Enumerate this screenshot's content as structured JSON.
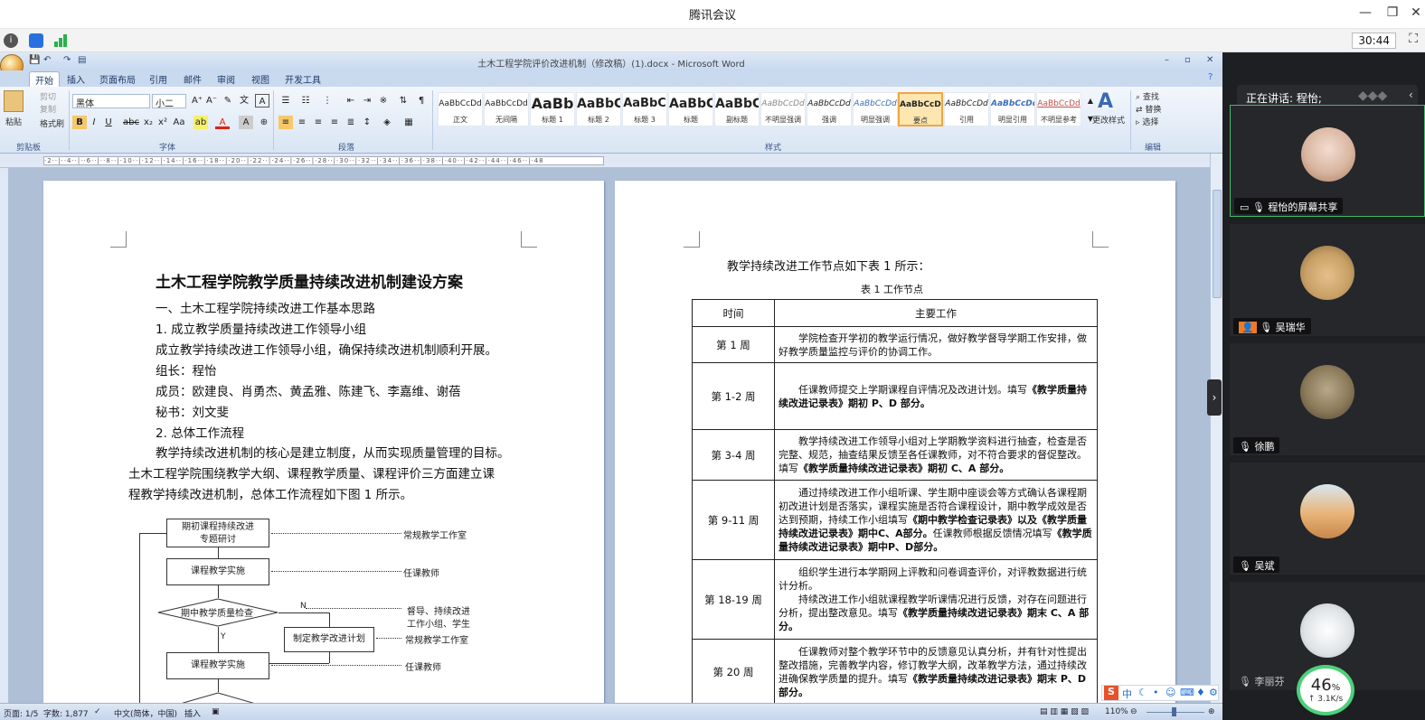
{
  "meeting": {
    "app_title": "腾讯会议",
    "timer": "30:44",
    "speaking_label": "正在讲话: 程怡;",
    "network": {
      "percent": "46",
      "percent_unit": "%",
      "speed": "3.1K/s"
    },
    "participants": [
      {
        "name": "程怡的屏幕共享",
        "avatar_color": "#d9b6a0"
      },
      {
        "name": "吴瑞华",
        "avatar_color": "#c8a066"
      },
      {
        "name": "徐鹏",
        "avatar_color": "#8a7a5a"
      },
      {
        "name": "吴斌",
        "avatar_color": "#c8874a"
      },
      {
        "name": "李丽芬",
        "avatar_color": "#dfe3e6"
      }
    ]
  },
  "word": {
    "window_title": "土木工程学院评价改进机制（修改稿）(1).docx - Microsoft Word",
    "tabs": [
      "开始",
      "插入",
      "页面布局",
      "引用",
      "邮件",
      "审阅",
      "视图",
      "开发工具"
    ],
    "clipboard": {
      "paste": "粘贴",
      "cut": "剪切",
      "copy": "复制",
      "format_painter": "格式刷",
      "group": "剪贴板"
    },
    "font": {
      "name": "黑体",
      "size": "小二",
      "group": "字体"
    },
    "paragraph_group": "段落",
    "styles_group": "样式",
    "editing_group": "编辑",
    "editing": {
      "find": "查找",
      "replace": "替换",
      "select": "选择",
      "change_styles": "更改样式"
    },
    "styles": [
      {
        "sample": "AaBbCcDd",
        "name": "正文"
      },
      {
        "sample": "AaBbCcDd",
        "name": "无间隔"
      },
      {
        "sample": "AaBb",
        "name": "标题 1"
      },
      {
        "sample": "AaBbC",
        "name": "标题 2"
      },
      {
        "sample": "AaBbC",
        "name": "标题 3"
      },
      {
        "sample": "AaBbC",
        "name": "标题"
      },
      {
        "sample": "AaBbC",
        "name": "副标题"
      },
      {
        "sample": "AaBbCcDd",
        "name": "不明显强调"
      },
      {
        "sample": "AaBbCcDd",
        "name": "强调"
      },
      {
        "sample": "AaBbCcDd",
        "name": "明显强调"
      },
      {
        "sample": "AaBbCcDd",
        "name": "要点"
      },
      {
        "sample": "AaBbCcDd",
        "name": "引用"
      },
      {
        "sample": "AaBbCcDd",
        "name": "明显引用"
      },
      {
        "sample": "AaBbCcDd",
        "name": "不明显参考"
      }
    ],
    "status": {
      "page": "页面: 1/5",
      "words": "字数: 1,877",
      "language": "中文(简体，中国)",
      "insert": "插入",
      "zoom": "110%"
    }
  },
  "page1": {
    "title": "土木工程学院教学质量持续改进机制建设方案",
    "lines": [
      "一、土木工程学院持续改进工作基本思路",
      "1. 成立教学质量持续改进工作领导小组",
      "成立教学持续改进工作领导小组，确保持续改进机制顺利开展。",
      "组长：程怡",
      "成员：欧建良、肖勇杰、黄孟雅、陈建飞、李嘉维、谢蓓",
      "秘书：刘文斐",
      "2. 总体工作流程",
      "教学持续改进机制的核心是建立制度，从而实现质量管理的目标。",
      "土木工程学院围绕教学大纲、课程教学质量、课程评价三方面建立课",
      "程教学持续改进机制，总体工作流程如下图 1 所示。"
    ],
    "flow": {
      "box1_a": "期初课程持续改进",
      "box1_b": "专题研讨",
      "box2": "课程教学实施",
      "diamond": "期中教学质量检查",
      "box3": "制定教学改进计划",
      "box4": "课程教学实施",
      "n_label": "N",
      "y_label": "Y",
      "note1": "常规教学工作室",
      "note2": "任课教师",
      "note3_a": "督导、持续改进",
      "note3_b": "工作小组、学生",
      "note4": "常规教学工作室",
      "note5": "任课教师"
    }
  },
  "page2": {
    "heading": "教学持续改进工作节点如下表 1 所示：",
    "caption": "表 1 工作节点",
    "col_time": "时间",
    "col_work": "主要工作",
    "rows": [
      {
        "time": "第 1 周",
        "text": "学院检查开学初的教学运行情况，做好教学督导学期工作安排，做好教学质量监控与评价的协调工作。",
        "bold": ""
      },
      {
        "time": "第 1-2 周",
        "text": "任课教师提交上学期课程自评情况及改进计划。填写",
        "bold": "《教学质量持续改进记录表》期初 P、D 部分。"
      },
      {
        "time": "第 3-4 周",
        "text": "教学持续改进工作领导小组对上学期教学资料进行抽查，检查是否完整、规范，抽查结果反馈至各任课教师，对不符合要求的督促整改。填写",
        "bold": "《教学质量持续改进记录表》期初 C、A 部分。"
      },
      {
        "time": "第 9-11 周",
        "text": "通过持续改进工作小组听课、学生期中座谈会等方式确认各课程期初改进计划是否落实，课程实施是否符合课程设计，期中教学成效是否达到预期，持续工作小组填写",
        "bold": "《期中教学检查记录表》以及《教学质量持续改进记录表》期中C、A部分。",
        "tail": "任课教师根据反馈情况填写",
        "bold2": "《教学质量持续改进记录表》期中P、D部分。"
      },
      {
        "time": "第 18-19 周",
        "text": "组织学生进行本学期网上评教和问卷调查评价，对评教数据进行统计分析。",
        "text2": "持续改进工作小组就课程教学听课情况进行反馈，对存在问题进行分析，提出整改意见。填写",
        "bold": "《教学质量持续改进记录表》期末 C、A 部分。"
      },
      {
        "time": "第 20 周",
        "text": "任课教师对整个教学环节中的反馈意见认真分析，并有针对性提出整改措施，完善教学内容，修订教学大纲，改革教学方法，通过持续改进确保教学质量的提升。填写",
        "bold": "《教学质量持续改进记录表》期末 P、D 部分。"
      }
    ]
  },
  "ime": {
    "label": "中"
  }
}
